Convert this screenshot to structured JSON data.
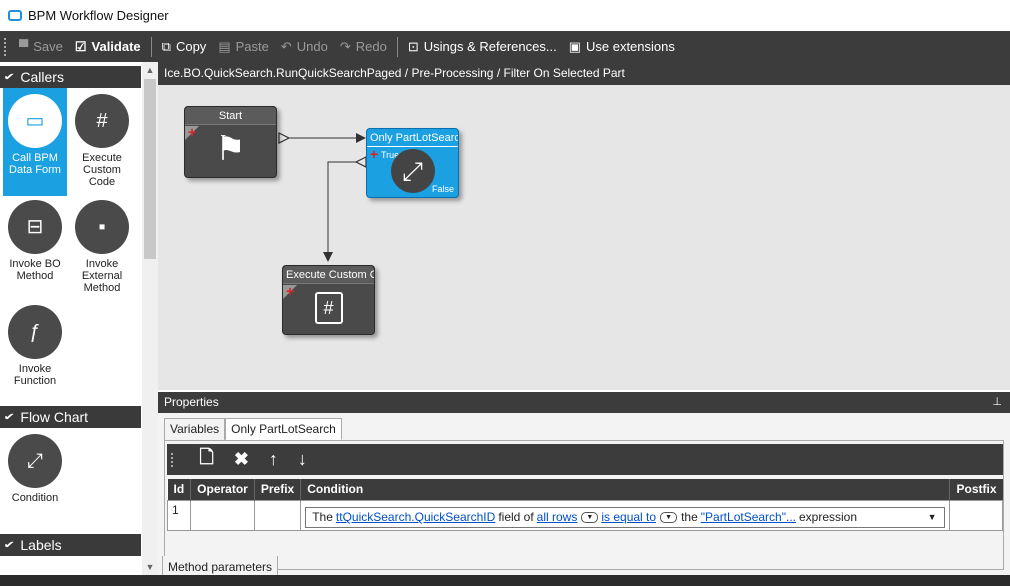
{
  "window": {
    "title": "BPM Workflow Designer"
  },
  "toolbar": {
    "save": "Save",
    "validate": "Validate",
    "copy": "Copy",
    "paste": "Paste",
    "undo": "Undo",
    "redo": "Redo",
    "usings": "Usings & References...",
    "use_ext": "Use extensions"
  },
  "sidebar": {
    "callers_title": "Callers",
    "callers": [
      {
        "label": "Call BPM Data Form",
        "icon": "data-form-icon"
      },
      {
        "label": "Execute Custom Code",
        "icon": "code-hash-icon"
      },
      {
        "label": "Invoke BO Method",
        "icon": "bo-method-icon"
      },
      {
        "label": "Invoke External Method",
        "icon": "external-method-icon"
      },
      {
        "label": "Invoke Function",
        "icon": "function-icon"
      }
    ],
    "flow_title": "Flow Chart",
    "flow": [
      {
        "label": "Condition",
        "icon": "condition-icon"
      }
    ],
    "labels_title": "Labels"
  },
  "breadcrumb": "Ice.BO.QuickSearch.RunQuickSearchPaged / Pre-Processing / Filter On Selected Part",
  "canvas": {
    "start_title": "Start",
    "cond_title": "Only PartLotSearch",
    "cond_true": "True",
    "cond_false": "False",
    "exec_title": "Execute Custom Code"
  },
  "properties": {
    "title": "Properties",
    "tabs": [
      "Variables",
      "Only PartLotSearch"
    ],
    "columns": [
      "Id",
      "Operator",
      "Prefix",
      "Condition",
      "Postfix"
    ],
    "row": {
      "id": "1",
      "operator": "",
      "prefix": "",
      "postfix": "",
      "cond_the": "The",
      "cond_field": "ttQuickSearch.QuickSearchID",
      "cond_fieldof": "field of",
      "cond_rows": "all rows",
      "cond_op": "is equal to",
      "cond_the2": "the",
      "cond_value": "\"PartLotSearch\"...",
      "cond_expr": "expression"
    }
  },
  "bottom_tab": "Method parameters",
  "colors": {
    "accent": "#1ba1e2",
    "dark": "#3c3c3c",
    "canvas": "#e6e6e6"
  }
}
